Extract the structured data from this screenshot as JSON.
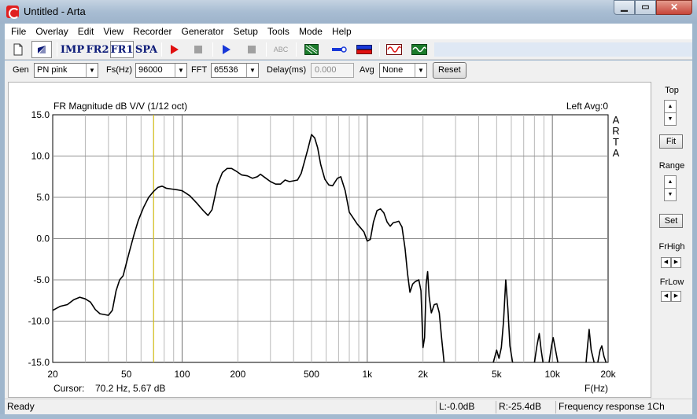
{
  "window": {
    "title": "Untitled - Arta"
  },
  "menu": [
    "File",
    "Overlay",
    "Edit",
    "View",
    "Recorder",
    "Generator",
    "Setup",
    "Tools",
    "Mode",
    "Help"
  ],
  "toolbar": {
    "imp": "IMP",
    "fr2": "FR2",
    "fr1": "FR1",
    "spa": "SPA",
    "abc": "ABC"
  },
  "genbar": {
    "gen_label": "Gen",
    "gen_value": "PN pink",
    "fs_label": "Fs(Hz)",
    "fs_value": "96000",
    "fft_label": "FFT",
    "fft_value": "65536",
    "delay_label": "Delay(ms)",
    "delay_value": "0.000",
    "avg_label": "Avg",
    "avg_value": "None",
    "reset": "Reset"
  },
  "graph": {
    "title": "FR Magnitude dB V/V (1/12 oct)",
    "channel": "Left  Avg:0",
    "brand": [
      "A",
      "R",
      "T",
      "A"
    ],
    "cursor_label": "Cursor:",
    "cursor_value": "70.2 Hz, 5.67 dB",
    "xunit": "F(Hz)"
  },
  "side": {
    "top": "Top",
    "fit": "Fit",
    "range": "Range",
    "set": "Set",
    "frhigh": "FrHigh",
    "frlow": "FrLow"
  },
  "status": {
    "ready": "Ready",
    "l": "L:-0.0dB",
    "r": "R:-25.4dB",
    "mode": "Frequency response 1Ch"
  },
  "chart_data": {
    "type": "line",
    "title": "FR Magnitude dB V/V (1/12 oct)",
    "xlabel": "F(Hz)",
    "ylabel": "",
    "xscale": "log",
    "xlim": [
      20,
      20000
    ],
    "ylim": [
      -15,
      15
    ],
    "xticks": [
      20,
      50,
      100,
      200,
      500,
      1000,
      2000,
      5000,
      10000,
      20000
    ],
    "xticklabels": [
      "20",
      "50",
      "100",
      "200",
      "500",
      "1k",
      "2k",
      "5k",
      "10k",
      "20k"
    ],
    "yticks": [
      15,
      10,
      5,
      0,
      -5,
      -10,
      -15
    ],
    "yticklabels": [
      "15.0",
      "10.0",
      "5.0",
      "0.0",
      "-5.0",
      "-10.0",
      "-15.0"
    ],
    "cursor_x": 70.2,
    "series": [
      {
        "color": "#000000",
        "segments": [
          [
            [
              20,
              -8.7
            ],
            [
              22,
              -8.2
            ],
            [
              24,
              -8.0
            ],
            [
              26,
              -7.4
            ],
            [
              28,
              -7.1
            ],
            [
              30,
              -7.3
            ],
            [
              32,
              -7.7
            ],
            [
              34,
              -8.6
            ],
            [
              36,
              -9.1
            ],
            [
              38,
              -9.2
            ],
            [
              40,
              -9.3
            ],
            [
              42,
              -8.7
            ],
            [
              44,
              -6.3
            ],
            [
              46,
              -5.0
            ],
            [
              48,
              -4.5
            ],
            [
              50,
              -3.0
            ],
            [
              52,
              -1.5
            ],
            [
              55,
              0.5
            ],
            [
              58,
              2.2
            ],
            [
              62,
              3.8
            ],
            [
              66,
              5.0
            ],
            [
              70,
              5.7
            ],
            [
              74,
              6.2
            ],
            [
              78,
              6.35
            ],
            [
              82,
              6.1
            ],
            [
              88,
              6.0
            ],
            [
              95,
              5.9
            ],
            [
              100,
              5.8
            ],
            [
              110,
              5.2
            ],
            [
              120,
              4.3
            ],
            [
              130,
              3.4
            ],
            [
              138,
              2.8
            ],
            [
              145,
              3.5
            ],
            [
              155,
              6.5
            ],
            [
              165,
              8.0
            ],
            [
              175,
              8.5
            ],
            [
              185,
              8.5
            ],
            [
              195,
              8.2
            ],
            [
              210,
              7.7
            ],
            [
              225,
              7.6
            ],
            [
              240,
              7.3
            ],
            [
              255,
              7.5
            ],
            [
              265,
              7.8
            ],
            [
              280,
              7.4
            ],
            [
              300,
              6.9
            ],
            [
              320,
              6.6
            ],
            [
              340,
              6.6
            ],
            [
              360,
              7.1
            ],
            [
              380,
              6.9
            ],
            [
              400,
              7.0
            ],
            [
              420,
              7.1
            ],
            [
              440,
              7.9
            ],
            [
              460,
              9.5
            ],
            [
              480,
              11.0
            ],
            [
              500,
              12.6
            ],
            [
              520,
              12.2
            ],
            [
              540,
              11.0
            ],
            [
              560,
              9.0
            ],
            [
              590,
              7.2
            ],
            [
              620,
              6.5
            ],
            [
              650,
              6.4
            ],
            [
              690,
              7.3
            ],
            [
              720,
              7.5
            ],
            [
              760,
              5.8
            ],
            [
              800,
              3.2
            ],
            [
              840,
              2.5
            ],
            [
              880,
              1.8
            ],
            [
              920,
              1.3
            ],
            [
              960,
              0.8
            ],
            [
              1000,
              -0.3
            ],
            [
              1040,
              -0.1
            ],
            [
              1080,
              2.0
            ],
            [
              1130,
              3.4
            ],
            [
              1180,
              3.6
            ],
            [
              1230,
              3.1
            ],
            [
              1280,
              2.0
            ],
            [
              1330,
              1.5
            ],
            [
              1380,
              1.9
            ],
            [
              1430,
              2.0
            ],
            [
              1480,
              2.1
            ],
            [
              1540,
              1.4
            ],
            [
              1600,
              -1.2
            ],
            [
              1650,
              -4.2
            ],
            [
              1700,
              -6.5
            ],
            [
              1760,
              -5.5
            ],
            [
              1820,
              -5.2
            ],
            [
              1900,
              -5.0
            ],
            [
              1950,
              -6.3
            ],
            [
              2000,
              -13.2
            ],
            [
              2040,
              -12.0
            ],
            [
              2080,
              -5.5
            ],
            [
              2120,
              -4.0
            ],
            [
              2160,
              -7.0
            ],
            [
              2220,
              -9.0
            ],
            [
              2300,
              -8.0
            ],
            [
              2380,
              -7.9
            ],
            [
              2450,
              -9.0
            ],
            [
              2520,
              -12.0
            ],
            [
              2600,
              -15.0
            ]
          ],
          [
            [
              4800,
              -15.0
            ],
            [
              5000,
              -13.5
            ],
            [
              5150,
              -14.5
            ],
            [
              5300,
              -13.2
            ],
            [
              5450,
              -10.0
            ],
            [
              5600,
              -5.0
            ],
            [
              5750,
              -8.5
            ],
            [
              5900,
              -13.0
            ],
            [
              6100,
              -15.0
            ]
          ],
          [
            [
              8000,
              -15.0
            ],
            [
              8250,
              -13.0
            ],
            [
              8500,
              -11.5
            ],
            [
              8700,
              -13.5
            ],
            [
              8900,
              -15.0
            ]
          ],
          [
            [
              9600,
              -15.0
            ],
            [
              9900,
              -13.0
            ],
            [
              10100,
              -12.0
            ],
            [
              10400,
              -13.5
            ],
            [
              10700,
              -15.0
            ]
          ],
          [
            [
              15200,
              -15.0
            ],
            [
              15500,
              -13.0
            ],
            [
              15800,
              -11.0
            ],
            [
              16200,
              -13.5
            ],
            [
              16800,
              -15.0
            ]
          ],
          [
            [
              17600,
              -15.0
            ],
            [
              18100,
              -13.5
            ],
            [
              18500,
              -13.0
            ],
            [
              19000,
              -14.3
            ],
            [
              19500,
              -15.0
            ]
          ]
        ]
      }
    ]
  }
}
